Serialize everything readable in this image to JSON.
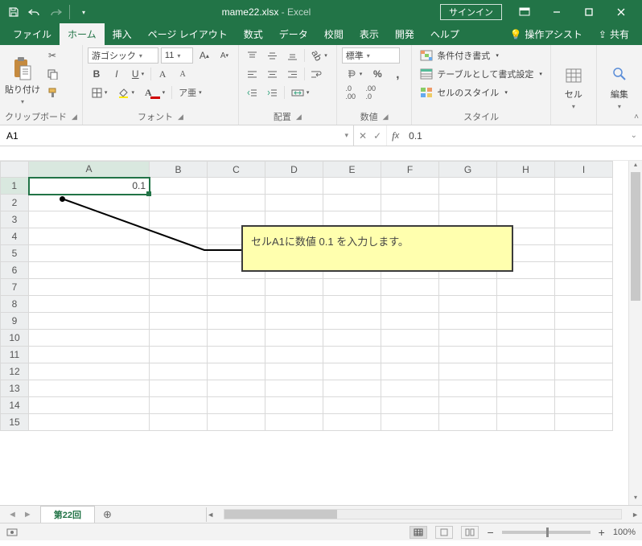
{
  "title": {
    "file": "mame22.xlsx",
    "sep": " - ",
    "app": "Excel"
  },
  "signin": "サインイン",
  "tabs": {
    "file": "ファイル",
    "home": "ホーム",
    "insert": "挿入",
    "layout": "ページ レイアウト",
    "formulas": "数式",
    "data": "データ",
    "review": "校閲",
    "view": "表示",
    "developer": "開発",
    "help": "ヘルプ",
    "assist": "操作アシスト",
    "share": "共有"
  },
  "ribbon": {
    "clipboard": {
      "paste": "貼り付け",
      "label": "クリップボード"
    },
    "font": {
      "name": "游ゴシック",
      "size": "11",
      "label": "フォント"
    },
    "align": {
      "label": "配置"
    },
    "number": {
      "format": "標準",
      "label": "数値"
    },
    "styles": {
      "cond": "条件付き書式",
      "table": "テーブルとして書式設定",
      "cell": "セルのスタイル",
      "label": "スタイル"
    },
    "cells": {
      "btn": "セル",
      "label": ""
    },
    "editing": {
      "btn": "編集",
      "label": ""
    }
  },
  "fbar": {
    "name": "A1",
    "value": "0.1"
  },
  "grid": {
    "cols": [
      "A",
      "B",
      "C",
      "D",
      "E",
      "F",
      "G",
      "H",
      "I"
    ],
    "rows": [
      "1",
      "2",
      "3",
      "4",
      "5",
      "6",
      "7",
      "8",
      "9",
      "10",
      "11",
      "12",
      "13",
      "14",
      "15"
    ],
    "a1": "0.1"
  },
  "callout": "セルA1に数値 0.1 を入力します。",
  "sheet": {
    "name": "第22回"
  },
  "status": {
    "zoom": "100%"
  }
}
